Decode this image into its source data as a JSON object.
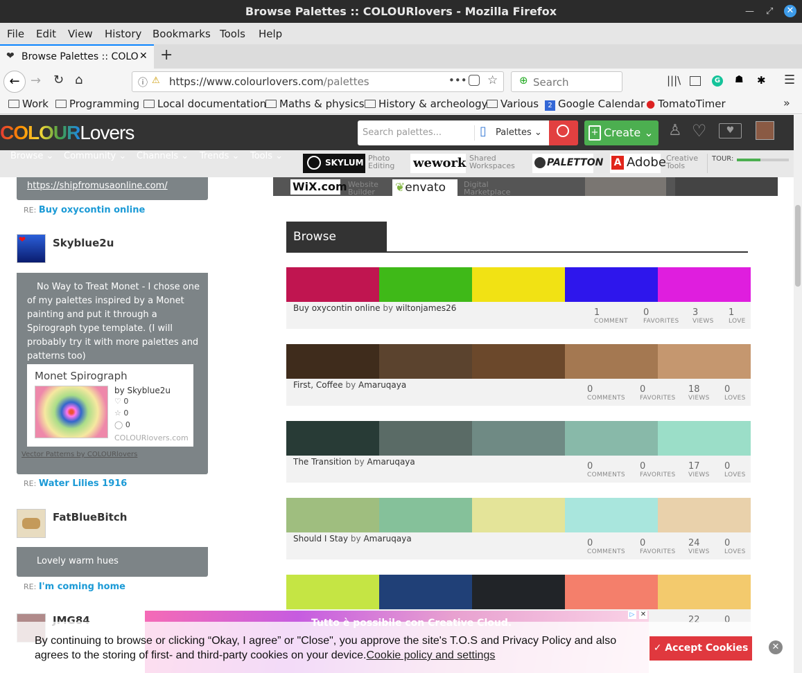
{
  "window": {
    "title": "Browse Palettes :: COLOURlovers - Mozilla Firefox"
  },
  "menu": [
    "File",
    "Edit",
    "View",
    "History",
    "Bookmarks",
    "Tools",
    "Help"
  ],
  "tab": {
    "title": "Browse Palettes :: COLO",
    "close": "✕",
    "new_tab": "+"
  },
  "nav": {
    "url_host": "https://www.colourlovers.com",
    "url_path": "/palettes",
    "search_placeholder": "Search",
    "more": "•••"
  },
  "bookmarks": [
    "Work",
    "Programming",
    "Local documentation",
    "Maths & physics",
    "History & archeology",
    "Various",
    "Google Calendar",
    "TomatoTimer"
  ],
  "site": {
    "logo_colour": "COLOUR",
    "logo_lovers": "Lovers",
    "search_placeholder": "Search palettes...",
    "search_scope": "Palettes",
    "create_label": "Create",
    "subnav": [
      "Browse",
      "Community",
      "Channels",
      "Trends",
      "Tools"
    ],
    "tour_label": "TOUR:",
    "sponsors": [
      {
        "name": "SKYLUM",
        "tag1": "Photo",
        "tag2": "Editing"
      },
      {
        "name": "wework",
        "tag1": "Shared",
        "tag2": "Workspaces"
      },
      {
        "name": "PALETTON",
        "tag1": "",
        "tag2": ""
      },
      {
        "name": "Adobe",
        "tag1": "Creative",
        "tag2": "Tools"
      },
      {
        "name": "WiX.com",
        "tag1": "Website",
        "tag2": "Builder"
      },
      {
        "name": "envato",
        "tag1": "Digital",
        "tag2": "Marketplace"
      }
    ]
  },
  "sidebar": {
    "top_link": "https://shipfromusaonline.com/",
    "items": [
      {
        "re": "RE:",
        "re_title": "Buy oxycontin online"
      },
      {
        "user": "Skyblue2u",
        "text": "No Way to Treat Monet - I chose one of my palettes inspired by a Monet painting and put it through a Spirograph type template. (I will probably try it with more palettes and patterns too)",
        "re": "RE:",
        "re_title": "Water Lilies 1916"
      },
      {
        "user": "FatBlueBitch",
        "text": "Lovely warm hues",
        "re": "RE:",
        "re_title": "I'm coming home"
      },
      {
        "user": "JMG84"
      }
    ],
    "card": {
      "title": "Monet Spirograph",
      "by": "by Skyblue2u",
      "loves": "0",
      "favs": "0",
      "comments": "0",
      "site": "COLOURlovers.com",
      "footer": "Vector Patterns by COLOURlovers"
    }
  },
  "main": {
    "heading": "Browse Palettes",
    "palettes": [
      {
        "colors": [
          "#c01550",
          "#3fb918",
          "#f1e214",
          "#2e16ec",
          "#df1ede"
        ],
        "title": "Buy oxycontin online",
        "by": "by",
        "author": "wiltonjames26",
        "comments": "1",
        "comments_label": "COMMENT",
        "favorites": "0",
        "favorites_label": "FAVORITES",
        "views": "3",
        "views_label": "VIEWS",
        "loves": "1",
        "loves_label": "LOVE"
      },
      {
        "colors": [
          "#3f2c1c",
          "#5b432e",
          "#6b482b",
          "#a47851",
          "#c5976f"
        ],
        "title": "First, Coffee",
        "by": "by",
        "author": "Amaruqaya",
        "comments": "0",
        "comments_label": "COMMENTS",
        "favorites": "0",
        "favorites_label": "FAVORITES",
        "views": "18",
        "views_label": "VIEWS",
        "loves": "0",
        "loves_label": "LOVES"
      },
      {
        "colors": [
          "#283b36",
          "#5a6b66",
          "#6f8a84",
          "#88b9a9",
          "#9bdec8"
        ],
        "title": "The Transition",
        "by": "by",
        "author": "Amaruqaya",
        "comments": "0",
        "comments_label": "COMMENTS",
        "favorites": "0",
        "favorites_label": "FAVORITES",
        "views": "17",
        "views_label": "VIEWS",
        "loves": "0",
        "loves_label": "LOVES"
      },
      {
        "colors": [
          "#9fbe7f",
          "#85c19a",
          "#e4e499",
          "#a9e6dd",
          "#e9d1ab"
        ],
        "title": "Should I Stay",
        "by": "by",
        "author": "Amaruqaya",
        "comments": "0",
        "comments_label": "COMMENTS",
        "favorites": "0",
        "favorites_label": "FAVORITES",
        "views": "24",
        "views_label": "VIEWS",
        "loves": "0",
        "loves_label": "LOVES"
      },
      {
        "colors": [
          "#c5e544",
          "#204077",
          "#212428",
          "#f47f6b",
          "#f3ca6d"
        ],
        "views": "22",
        "loves": "0"
      }
    ]
  },
  "ad": {
    "headline": "Tutto è possibile con Creative Cloud."
  },
  "cookie": {
    "text": "By continuing to browse or clicking “Okay, I agree” or \"Close\", you approve the site's T.O.S and Privacy Policy and also agrees to the storing of first- and third-party cookies on your device.",
    "link": "Cookie policy and settings",
    "accept": "✓ Accept Cookies",
    "close": "✕"
  }
}
